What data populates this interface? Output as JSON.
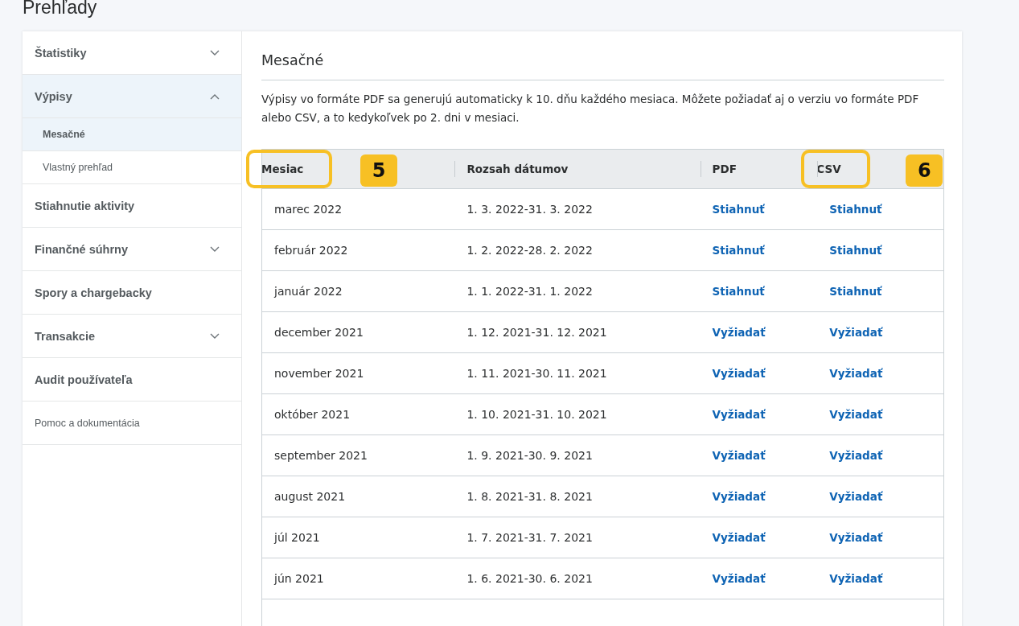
{
  "page_title": "Prehľady",
  "sidebar": {
    "items": [
      {
        "label": "Štatistiky",
        "kind": "section",
        "expanded": false,
        "selected": false
      },
      {
        "label": "Výpisy",
        "kind": "section",
        "expanded": true,
        "selected": true,
        "children": [
          {
            "label": "Mesačné",
            "selected": true
          },
          {
            "label": "Vlastný prehľad",
            "selected": false
          }
        ]
      },
      {
        "label": "Stiahnutie aktivity",
        "kind": "section",
        "selected": false
      },
      {
        "label": "Finančné súhrny",
        "kind": "section",
        "expanded": false,
        "selected": false
      },
      {
        "label": "Spory a chargebacky",
        "kind": "section",
        "selected": false
      },
      {
        "label": "Transakcie",
        "kind": "section",
        "expanded": false,
        "selected": false
      },
      {
        "label": "Audit používateľa",
        "kind": "section",
        "selected": false
      },
      {
        "label": "Pomoc a dokumentácia",
        "kind": "link",
        "selected": false
      }
    ]
  },
  "content": {
    "heading": "Mesačné",
    "description": "Výpisy vo formáte PDF sa generujú automaticky k 10. dňu každého mesiaca. Môžete požiadať aj o verziu vo formáte PDF alebo CSV, a to kedykoľvek po 2. dni v mesiaci.",
    "table": {
      "columns": [
        {
          "label": "Mesiac",
          "highlighted": true,
          "callout": "5"
        },
        {
          "label": "Rozsah dátumov",
          "highlighted": false
        },
        {
          "label": "PDF",
          "highlighted": false
        },
        {
          "label": "CSV",
          "highlighted": true,
          "callout": "6"
        }
      ],
      "rows": [
        [
          "marec 2022",
          "1. 3. 2022-31. 3. 2022",
          "Stiahnuť",
          "Stiahnuť"
        ],
        [
          "február 2022",
          "1. 2. 2022-28. 2. 2022",
          "Stiahnuť",
          "Stiahnuť"
        ],
        [
          "január 2022",
          "1. 1. 2022-31. 1. 2022",
          "Stiahnuť",
          "Stiahnuť"
        ],
        [
          "december 2021",
          "1. 12. 2021-31. 12. 2021",
          "Vyžiadať",
          "Vyžiadať"
        ],
        [
          "november 2021",
          "1. 11. 2021-30. 11. 2021",
          "Vyžiadať",
          "Vyžiadať"
        ],
        [
          "október 2021",
          "1. 10. 2021-31. 10. 2021",
          "Vyžiadať",
          "Vyžiadať"
        ],
        [
          "september 2021",
          "1. 9. 2021-30. 9. 2021",
          "Vyžiadať",
          "Vyžiadať"
        ],
        [
          "august 2021",
          "1. 8. 2021-31. 8. 2021",
          "Vyžiadať",
          "Vyžiadať"
        ],
        [
          "júl 2021",
          "1. 7. 2021-31. 7. 2021",
          "Vyžiadať",
          "Vyžiadať"
        ],
        [
          "jún 2021",
          "1. 6. 2021-30. 6. 2021",
          "Vyžiadať",
          "Vyžiadať"
        ]
      ]
    }
  }
}
